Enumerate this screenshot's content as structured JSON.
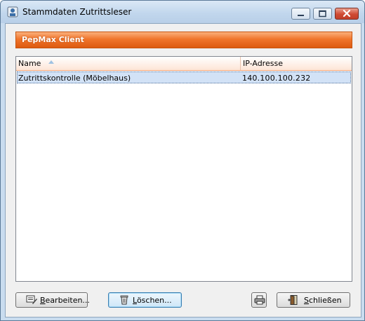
{
  "window": {
    "title": "Stammdaten Zutrittsleser"
  },
  "banner": {
    "text": "PepMax Client"
  },
  "list": {
    "columns": [
      {
        "label": "Name",
        "sort": "ascending"
      },
      {
        "label": "IP-Adresse"
      }
    ],
    "rows": [
      {
        "name": "Zutrittskontrolle (Möbelhaus)",
        "ip": "140.100.100.232",
        "selected": true
      }
    ]
  },
  "buttons": {
    "edit": {
      "first": "B",
      "rest": "earbeiten...",
      "icon": "edit-icon"
    },
    "delete": {
      "first": "L",
      "rest": "öschen...",
      "icon": "trash-icon"
    },
    "print": {
      "icon": "printer-icon"
    },
    "close": {
      "first": "S",
      "rest": "chließen",
      "icon": "door-exit-icon"
    }
  },
  "caption_buttons": [
    "minimize-icon",
    "maximize-icon",
    "close-icon"
  ],
  "colors": {
    "banner": "#f0752c",
    "selection": "#d2e2f6",
    "titlebar": "#c2d7ed",
    "close_button": "#cf4a33"
  }
}
